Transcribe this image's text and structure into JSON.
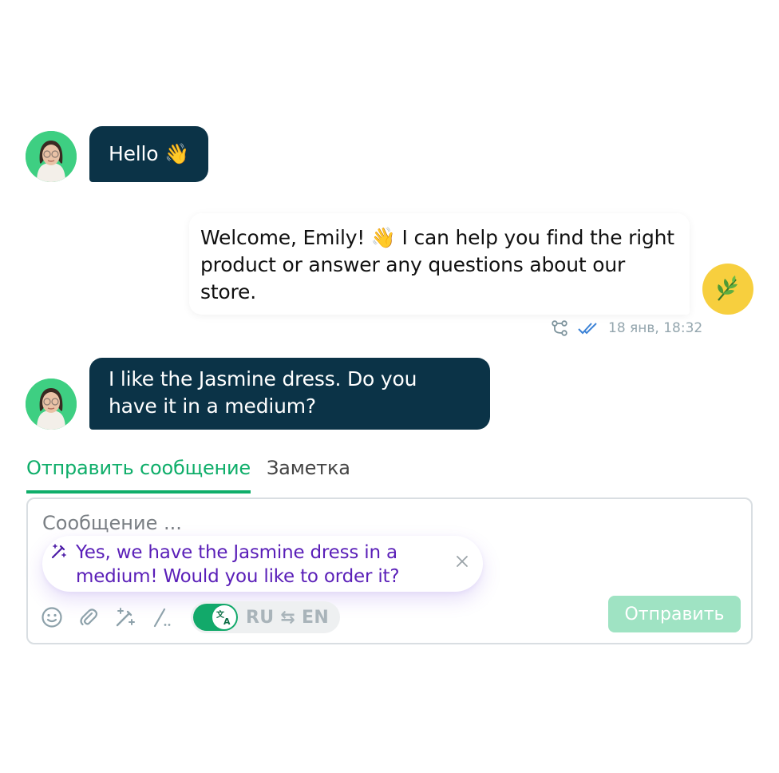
{
  "messages": [
    {
      "from": "user",
      "text": "Hello 👋"
    },
    {
      "from": "bot",
      "text": "Welcome, Emily! 👋 I can help you find the right product or answer any questions about our store.",
      "meta": {
        "timestamp": "18 янв, 18:32"
      }
    },
    {
      "from": "user",
      "text": "I like the Jasmine dress. Do you have it in a medium?"
    }
  ],
  "composer": {
    "tabs": [
      {
        "label": "Отправить сообщение",
        "active": true
      },
      {
        "label": "Заметка",
        "active": false
      }
    ],
    "placeholder": "Сообщение ...",
    "suggestion": "Yes, we have the Jasmine dress in a medium! Would you like to order it?",
    "translate": {
      "enabled": true,
      "label": "RU ⇆ EN"
    },
    "send_label": "Отправить",
    "toolbar_icons": [
      "emoji-icon",
      "attach-icon",
      "ai-magic-icon",
      "slash-command-icon",
      "translate-icon"
    ]
  },
  "colors": {
    "incoming_bubble": "#0b3347",
    "accent_green": "#0fae6a",
    "suggestion_text": "#5a1fb8",
    "bot_avatar": "#f7cf3e",
    "user_avatar": "#3ecf82",
    "send_button_disabled": "#9fe3c3"
  }
}
